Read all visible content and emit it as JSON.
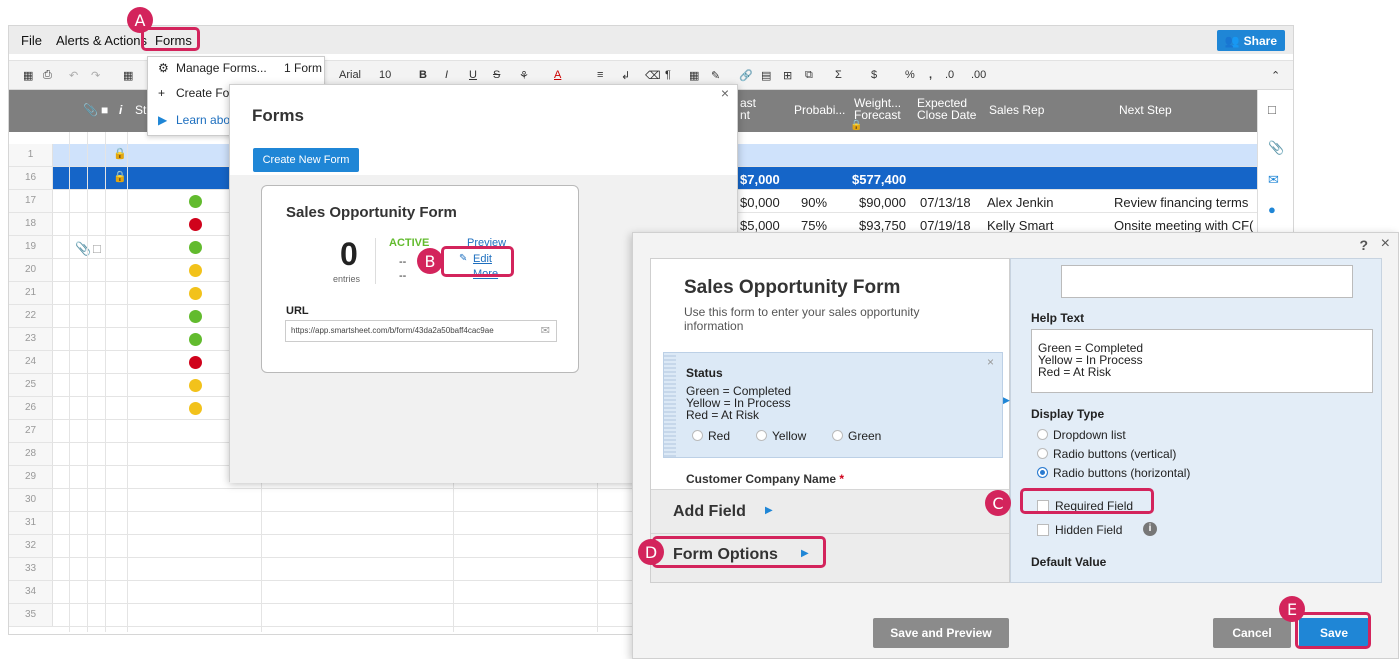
{
  "menu": {
    "file": "File",
    "alerts": "Alerts & Actions",
    "forms": "Forms",
    "share": "Share"
  },
  "toolbar": {
    "font": "Arial",
    "font_size": "10",
    "bold": "B",
    "italic": "I",
    "underline": "U",
    "strike": "S",
    "sigma": "Σ",
    "dollar": "$",
    "percent": "%",
    "comma": ",",
    "dec_dec": ".0",
    "dec_inc": ".00"
  },
  "grid": {
    "headers": {
      "status_abbrev": "St",
      "forecast": "ast\nnt",
      "probability": "Probabi...",
      "weighted": "Weight...\nForecast",
      "expected": "Expected\nClose Date",
      "sales_rep": "Sales Rep",
      "next_step": "Next Step"
    },
    "rows": [
      {
        "num": "1"
      },
      {
        "num": "16",
        "forecast": "$7,000",
        "weighted": "$577,400"
      },
      {
        "num": "17",
        "status": "green",
        "forecast": "$0,000",
        "probability": "90%",
        "weighted": "$90,000",
        "close": "07/13/18",
        "rep": "Alex Jenkin",
        "next": "Review financing terms"
      },
      {
        "num": "18",
        "status": "red",
        "forecast": "$5,000",
        "probability": "75%",
        "weighted": "$93,750",
        "close": "07/19/18",
        "rep": "Kelly Smart",
        "next": "Onsite meeting with CF("
      },
      {
        "num": "19",
        "status": "green"
      },
      {
        "num": "20",
        "status": "yellow"
      },
      {
        "num": "21",
        "status": "yellow"
      },
      {
        "num": "22",
        "status": "green"
      },
      {
        "num": "23",
        "status": "green"
      },
      {
        "num": "24",
        "status": "red"
      },
      {
        "num": "25",
        "status": "yellow"
      },
      {
        "num": "26",
        "status": "yellow"
      },
      {
        "num": "27"
      },
      {
        "num": "28"
      },
      {
        "num": "29"
      },
      {
        "num": "30"
      },
      {
        "num": "31"
      },
      {
        "num": "32"
      },
      {
        "num": "33"
      },
      {
        "num": "34"
      },
      {
        "num": "35"
      }
    ]
  },
  "dropdown": {
    "manage_forms": "Manage Forms...",
    "form_count": "1 Form",
    "create_form": "Create Fo",
    "learn_about": "Learn abo"
  },
  "forms_panel": {
    "title": "Forms",
    "create_button": "Create New Form",
    "card": {
      "title": "Sales Opportunity Form",
      "entries_count": "0",
      "entries_label": "entries",
      "status": "ACTIVE",
      "dash1": "--",
      "dash2": "--",
      "preview": "Preview",
      "edit": "Edit",
      "more": "More",
      "url_label": "URL",
      "url": "https://app.smartsheet.com/b/form/43da2a50baff4cac9ae"
    }
  },
  "editor": {
    "form_title": "Sales Opportunity Form",
    "description": "Use this form to enter your sales opportunity information",
    "status_field": {
      "label": "Status",
      "help_lines": [
        "Green = Completed",
        "Yellow = In Process",
        "Red = At Risk"
      ],
      "options": [
        "Red",
        "Yellow",
        "Green"
      ]
    },
    "customer_label": "Customer Company Name",
    "required_marker": "*",
    "add_field": "Add Field",
    "form_options": "Form Options",
    "help_text_label": "Help Text",
    "help_text_lines": [
      "Green = Completed",
      "Yellow = In Process",
      "Red = At Risk"
    ],
    "display_type_label": "Display Type",
    "display_options": [
      "Dropdown list",
      "Radio buttons (vertical)",
      "Radio buttons (horizontal)"
    ],
    "display_selected": "Radio buttons (horizontal)",
    "required_field": "Required Field",
    "hidden_field": "Hidden Field",
    "default_value": "Default Value",
    "save_preview": "Save and Preview",
    "cancel": "Cancel",
    "save": "Save",
    "help_icon": "?",
    "close_icon": "×"
  },
  "callouts": {
    "a": "A",
    "b": "B",
    "c": "C",
    "d": "D",
    "e": "E"
  },
  "colors": {
    "status_green": "#62bb2e",
    "status_red": "#d0021b",
    "status_yellow": "#f2c21b",
    "accent": "#1f86d6",
    "callout": "#d3245c"
  }
}
